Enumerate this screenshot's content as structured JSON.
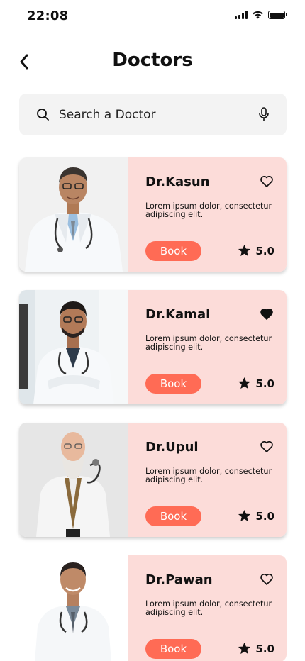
{
  "status_bar": {
    "time": "22:08"
  },
  "header": {
    "title": "Doctors"
  },
  "search": {
    "placeholder": "Search a Doctor"
  },
  "doctors": [
    {
      "name": "Dr.Kasun",
      "description": "Lorem ipsum dolor, consectetur adipiscing elit.",
      "book_label": "Book",
      "rating": "5.0",
      "favorited": false
    },
    {
      "name": "Dr.Kamal",
      "description": "Lorem ipsum dolor, consectetur adipiscing elit.",
      "book_label": "Book",
      "rating": "5.0",
      "favorited": true
    },
    {
      "name": "Dr.Upul",
      "description": "Lorem ipsum dolor, consectetur adipiscing elit.",
      "book_label": "Book",
      "rating": "5.0",
      "favorited": false
    },
    {
      "name": "Dr.Pawan",
      "description": "Lorem ipsum dolor, consectetur adipiscing elit.",
      "book_label": "Book",
      "rating": "5.0",
      "favorited": false
    }
  ],
  "colors": {
    "card_background": "#fcdcd9",
    "accent": "#ff6b55",
    "search_background": "#f3f3f3"
  },
  "icons": [
    "back-arrow-icon",
    "search-icon",
    "microphone-icon",
    "heart-icon",
    "star-icon",
    "signal-icon",
    "wifi-icon",
    "battery-icon"
  ]
}
